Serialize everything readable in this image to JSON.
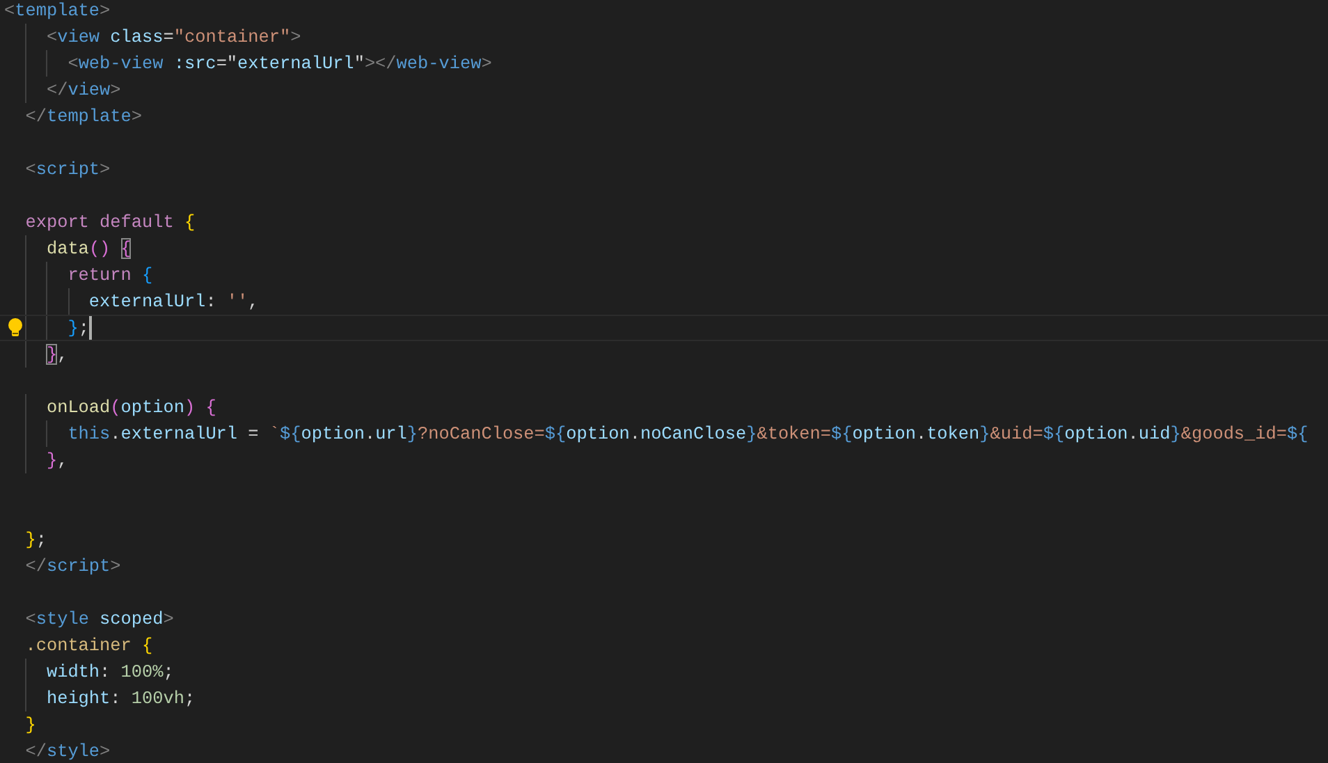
{
  "editor": {
    "lines": [
      {
        "current": false,
        "lightbulb": false,
        "tokens": [
          {
            "kind": "punct",
            "text": "<"
          },
          {
            "kind": "tag",
            "text": "template"
          },
          {
            "kind": "punct",
            "text": ">"
          }
        ]
      },
      {
        "current": false,
        "lightbulb": false,
        "tokens": [
          {
            "kind": "punct",
            "text": "    <"
          },
          {
            "kind": "tag",
            "text": "view "
          },
          {
            "kind": "attr",
            "text": "class"
          },
          {
            "kind": "plain",
            "text": "="
          },
          {
            "kind": "string",
            "text": "\"container\""
          },
          {
            "kind": "punct",
            "text": ">"
          }
        ]
      },
      {
        "current": false,
        "lightbulb": false,
        "tokens": [
          {
            "kind": "punct",
            "text": "      <"
          },
          {
            "kind": "tag",
            "text": "web-view "
          },
          {
            "kind": "attr",
            "text": ":src"
          },
          {
            "kind": "plain",
            "text": "=\""
          },
          {
            "kind": "var",
            "text": "externalUrl"
          },
          {
            "kind": "plain",
            "text": "\""
          },
          {
            "kind": "punct",
            "text": "></"
          },
          {
            "kind": "tag",
            "text": "web-view"
          },
          {
            "kind": "punct",
            "text": ">"
          }
        ]
      },
      {
        "current": false,
        "lightbulb": false,
        "tokens": [
          {
            "kind": "punct",
            "text": "    </"
          },
          {
            "kind": "tag",
            "text": "view"
          },
          {
            "kind": "punct",
            "text": ">"
          }
        ]
      },
      {
        "current": false,
        "lightbulb": false,
        "tokens": [
          {
            "kind": "punct",
            "text": "  </"
          },
          {
            "kind": "tag",
            "text": "template"
          },
          {
            "kind": "punct",
            "text": ">"
          }
        ]
      },
      {
        "current": false,
        "lightbulb": false
      },
      {
        "current": false,
        "lightbulb": false,
        "tokens": [
          {
            "kind": "punct",
            "text": "  <"
          },
          {
            "kind": "tag",
            "text": "script"
          },
          {
            "kind": "punct",
            "text": ">"
          }
        ]
      },
      {
        "current": false,
        "lightbulb": false
      },
      {
        "current": false,
        "lightbulb": false,
        "tokens": [
          {
            "kind": "keyword",
            "text": "  export default "
          },
          {
            "kind": "bracket1",
            "text": "{"
          }
        ]
      },
      {
        "current": false,
        "lightbulb": false,
        "tokens": [
          {
            "kind": "fn",
            "text": "    data"
          },
          {
            "kind": "bracket2",
            "text": "() "
          },
          {
            "kind": "matched2",
            "text": "{"
          }
        ]
      },
      {
        "current": false,
        "lightbulb": false,
        "tokens": [
          {
            "kind": "keyword",
            "text": "      return "
          },
          {
            "kind": "bracket3",
            "text": "{"
          }
        ]
      },
      {
        "current": false,
        "lightbulb": false,
        "tokens": [
          {
            "kind": "var",
            "text": "        externalUrl"
          },
          {
            "kind": "plain",
            "text": ": "
          },
          {
            "kind": "string",
            "text": "''"
          },
          {
            "kind": "plain",
            "text": ","
          }
        ]
      },
      {
        "current": true,
        "lightbulb": true,
        "tokens": [
          {
            "kind": "bracket3",
            "text": "      }"
          },
          {
            "kind": "plain",
            "text": ";"
          }
        ]
      },
      {
        "current": false,
        "lightbulb": false,
        "tokens": [
          {
            "kind": "matched2",
            "text": "    }"
          },
          {
            "kind": "plain",
            "text": ","
          }
        ]
      },
      {
        "current": false,
        "lightbulb": false
      },
      {
        "current": false,
        "lightbulb": false,
        "tokens": [
          {
            "kind": "fn",
            "text": "    onLoad"
          },
          {
            "kind": "bracket2",
            "text": "("
          },
          {
            "kind": "var",
            "text": "option"
          },
          {
            "kind": "bracket2",
            "text": ") {"
          }
        ]
      },
      {
        "current": false,
        "lightbulb": false,
        "tokens": [
          {
            "kind": "this",
            "text": "      this"
          },
          {
            "kind": "plain",
            "text": "."
          },
          {
            "kind": "var",
            "text": "externalUrl"
          },
          {
            "kind": "plain",
            "text": " = "
          },
          {
            "kind": "string",
            "text": "`"
          },
          {
            "kind": "interp",
            "text": "${"
          },
          {
            "kind": "var",
            "text": "option"
          },
          {
            "kind": "plain",
            "text": "."
          },
          {
            "kind": "var",
            "text": "url"
          },
          {
            "kind": "interp",
            "text": "}"
          },
          {
            "kind": "string",
            "text": "?noCanClose="
          },
          {
            "kind": "interp",
            "text": "${"
          },
          {
            "kind": "var",
            "text": "option"
          },
          {
            "kind": "plain",
            "text": "."
          },
          {
            "kind": "var",
            "text": "noCanClose"
          },
          {
            "kind": "interp",
            "text": "}"
          },
          {
            "kind": "string",
            "text": "&token="
          },
          {
            "kind": "interp",
            "text": "${"
          },
          {
            "kind": "var",
            "text": "option"
          },
          {
            "kind": "plain",
            "text": "."
          },
          {
            "kind": "var",
            "text": "token"
          },
          {
            "kind": "interp",
            "text": "}"
          },
          {
            "kind": "string",
            "text": "&uid="
          },
          {
            "kind": "interp",
            "text": "${"
          },
          {
            "kind": "var",
            "text": "option"
          },
          {
            "kind": "plain",
            "text": "."
          },
          {
            "kind": "var",
            "text": "uid"
          },
          {
            "kind": "interp",
            "text": "}"
          },
          {
            "kind": "string",
            "text": "&goods_id="
          },
          {
            "kind": "interp",
            "text": "${"
          }
        ]
      },
      {
        "current": false,
        "lightbulb": false,
        "tokens": [
          {
            "kind": "bracket2",
            "text": "    }"
          },
          {
            "kind": "plain",
            "text": ","
          }
        ]
      },
      {
        "current": false,
        "lightbulb": false
      },
      {
        "current": false,
        "lightbulb": false
      },
      {
        "current": false,
        "lightbulb": false,
        "tokens": [
          {
            "kind": "bracket1",
            "text": "  }"
          },
          {
            "kind": "plain",
            "text": ";"
          }
        ]
      },
      {
        "current": false,
        "lightbulb": false,
        "tokens": [
          {
            "kind": "punct",
            "text": "  </"
          },
          {
            "kind": "tag",
            "text": "script"
          },
          {
            "kind": "punct",
            "text": ">"
          }
        ]
      },
      {
        "current": false,
        "lightbulb": false
      },
      {
        "current": false,
        "lightbulb": false,
        "tokens": [
          {
            "kind": "punct",
            "text": "  <"
          },
          {
            "kind": "tag",
            "text": "style "
          },
          {
            "kind": "attr",
            "text": "scoped"
          },
          {
            "kind": "punct",
            "text": ">"
          }
        ]
      },
      {
        "current": false,
        "lightbulb": false,
        "tokens": [
          {
            "kind": "selector",
            "text": "  .container "
          },
          {
            "kind": "bracket1",
            "text": "{"
          }
        ]
      },
      {
        "current": false,
        "lightbulb": false,
        "tokens": [
          {
            "kind": "var",
            "text": "    width"
          },
          {
            "kind": "plain",
            "text": ": "
          },
          {
            "kind": "number",
            "text": "100%"
          },
          {
            "kind": "plain",
            "text": ";"
          }
        ]
      },
      {
        "current": false,
        "lightbulb": false,
        "tokens": [
          {
            "kind": "var",
            "text": "    height"
          },
          {
            "kind": "plain",
            "text": ": "
          },
          {
            "kind": "number",
            "text": "100vh"
          },
          {
            "kind": "plain",
            "text": ";"
          }
        ]
      },
      {
        "current": false,
        "lightbulb": false,
        "tokens": [
          {
            "kind": "bracket1",
            "text": "  }"
          }
        ]
      },
      {
        "current": false,
        "lightbulb": false,
        "tokens": [
          {
            "kind": "punct",
            "text": "  </"
          },
          {
            "kind": "tag",
            "text": "style"
          },
          {
            "kind": "punct",
            "text": ">"
          }
        ]
      }
    ]
  }
}
